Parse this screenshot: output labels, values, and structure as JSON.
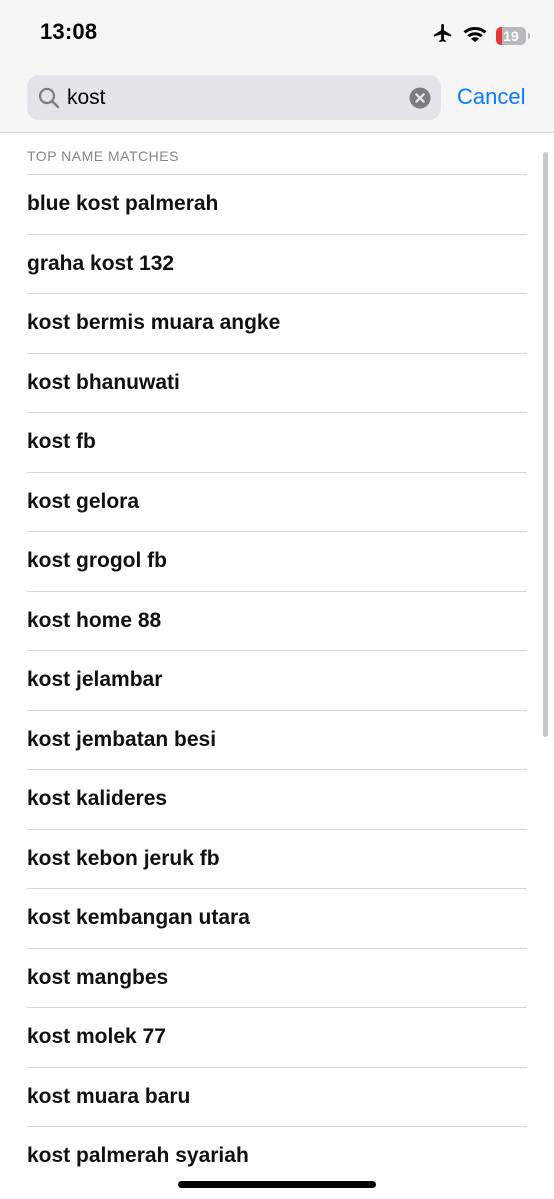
{
  "status_bar": {
    "time": "13:08",
    "battery_level": "19",
    "icons": [
      "airplane-icon",
      "wifi-icon",
      "battery-icon"
    ],
    "battery_color": "#e5383b"
  },
  "search": {
    "query": "kost",
    "icon": "search-icon",
    "clear_icon": "clear-icon",
    "cancel_label": "Cancel"
  },
  "results": {
    "section_header": "TOP NAME MATCHES",
    "items": [
      "blue kost palmerah",
      "graha kost 132",
      "kost bermis muara angke",
      "kost bhanuwati",
      "kost fb",
      "kost gelora",
      "kost grogol fb",
      "kost home 88",
      "kost jelambar",
      "kost jembatan besi",
      "kost kalideres",
      "kost kebon jeruk fb",
      "kost kembangan utara",
      "kost mangbes",
      "kost molek 77",
      "kost muara baru",
      "kost palmerah syariah"
    ]
  },
  "colors": {
    "accent": "#0a7aff",
    "section_header": "#858589",
    "separator": "#d8d8dc"
  }
}
